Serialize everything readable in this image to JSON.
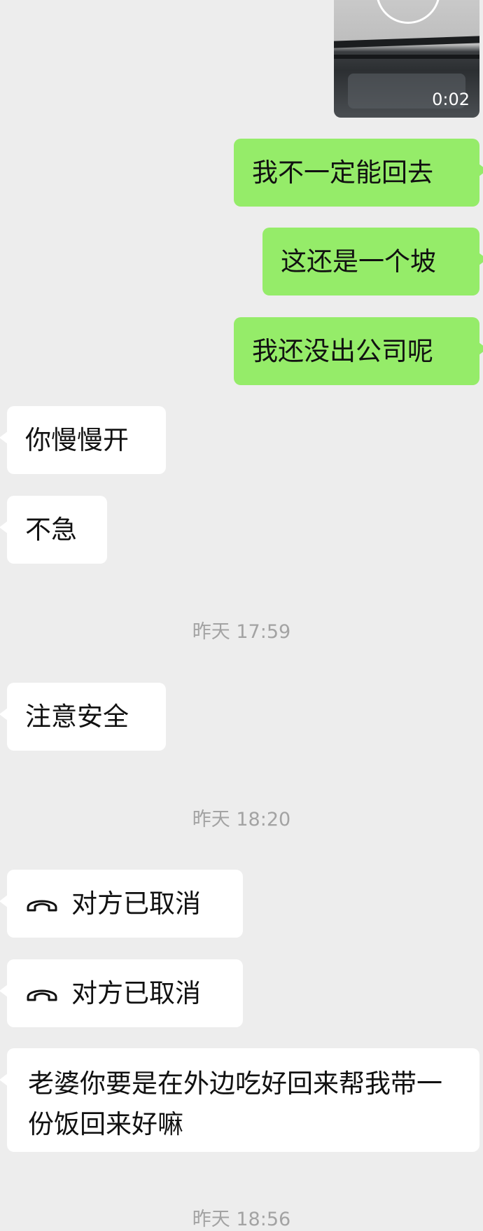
{
  "video_message": {
    "duration": "0:02"
  },
  "messages": [
    {
      "direction": "out",
      "text": "我不一定能回去"
    },
    {
      "direction": "out",
      "text": "这还是一个坡"
    },
    {
      "direction": "out",
      "text": "我还没出公司呢"
    },
    {
      "direction": "in",
      "text": "你慢慢开"
    },
    {
      "direction": "in",
      "text": "不急"
    },
    {
      "direction": "in",
      "text": "注意安全"
    },
    {
      "direction": "in",
      "type": "call",
      "text": "对方已取消",
      "icon": "hangup-phone-icon"
    },
    {
      "direction": "in",
      "type": "call",
      "text": "对方已取消",
      "icon": "hangup-phone-icon"
    },
    {
      "direction": "in",
      "text": "老婆你要是在外边吃好回来帮我带一份饭回来好嘛"
    }
  ],
  "timestamps": [
    "昨天 17:59",
    "昨天 18:20",
    "昨天 18:56"
  ],
  "colors": {
    "background": "#ededed",
    "outgoing_bubble": "#95ec69",
    "incoming_bubble": "#ffffff",
    "timestamp": "#a3a3a3"
  }
}
